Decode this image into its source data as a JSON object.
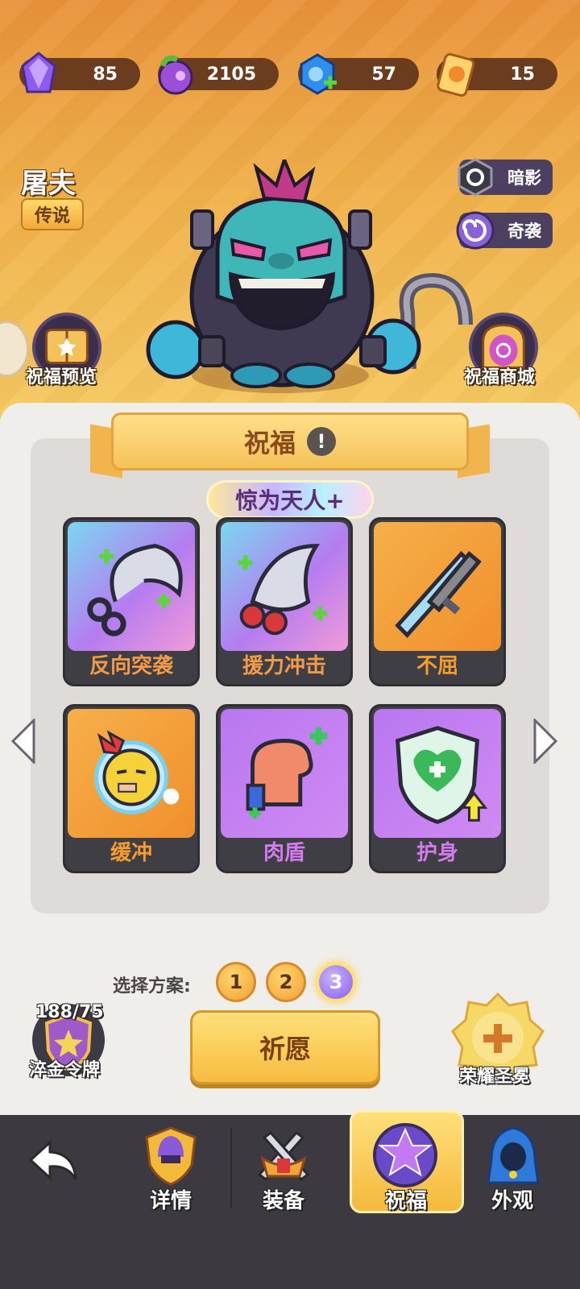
{
  "resources": [
    {
      "name": "crystal",
      "value": "85",
      "icon": "purple-crystal-icon"
    },
    {
      "name": "fruit",
      "value": "2105",
      "icon": "magic-fruit-icon"
    },
    {
      "name": "gem",
      "value": "57",
      "icon": "blue-gem-plus-icon"
    },
    {
      "name": "ticket",
      "value": "15",
      "icon": "orange-ticket-icon"
    }
  ],
  "hero": {
    "name": "屠夫",
    "rarity": "传说"
  },
  "traits": [
    {
      "label": "暗影",
      "icon": "shadow-icon"
    },
    {
      "label": "奇袭",
      "icon": "ambush-swirl-icon"
    }
  ],
  "side_buttons": {
    "preview": "祝福预览",
    "shop": "祝福商城"
  },
  "blessing": {
    "title": "祝福",
    "info_glyph": "!",
    "tier": "惊为天人+",
    "cards": [
      {
        "name": "反向突袭",
        "icon": "chain-hook-icon",
        "style": "rainbow"
      },
      {
        "name": "援力冲击",
        "icon": "hook-dash-icon",
        "style": "rainbow"
      },
      {
        "name": "不屈",
        "icon": "crossed-swords-icon",
        "style": "orange"
      },
      {
        "name": "缓冲",
        "icon": "dizzy-face-icon",
        "style": "orange"
      },
      {
        "name": "肉盾",
        "icon": "muscle-arm-icon",
        "style": "purple"
      },
      {
        "name": "护身",
        "icon": "heart-shield-icon",
        "style": "purple"
      }
    ]
  },
  "plan": {
    "label": "选择方案:",
    "options": [
      "1",
      "2",
      "3"
    ],
    "selected": "3"
  },
  "wish_button": "祈愿",
  "token": {
    "count": "188/75",
    "label": "淬金令牌"
  },
  "glory": {
    "label": "荣耀圣冕"
  },
  "nav": {
    "back_icon": "back-arrow-icon",
    "items": [
      {
        "label": "详情",
        "icon": "helmet-shield-icon"
      },
      {
        "label": "装备",
        "icon": "crossed-weapons-icon"
      },
      {
        "label": "祝福",
        "icon": "purple-star-icon"
      },
      {
        "label": "外观",
        "icon": "blue-hood-icon"
      }
    ],
    "active": "祝福"
  },
  "colors": {
    "rainbow_card": "#b57cf0",
    "orange_card": "#f3a03a",
    "purple_card": "#c77ff0",
    "rainbow_text": "#f39a4a",
    "orange_text": "#f59d2e",
    "purple_text": "#d27cf0"
  }
}
